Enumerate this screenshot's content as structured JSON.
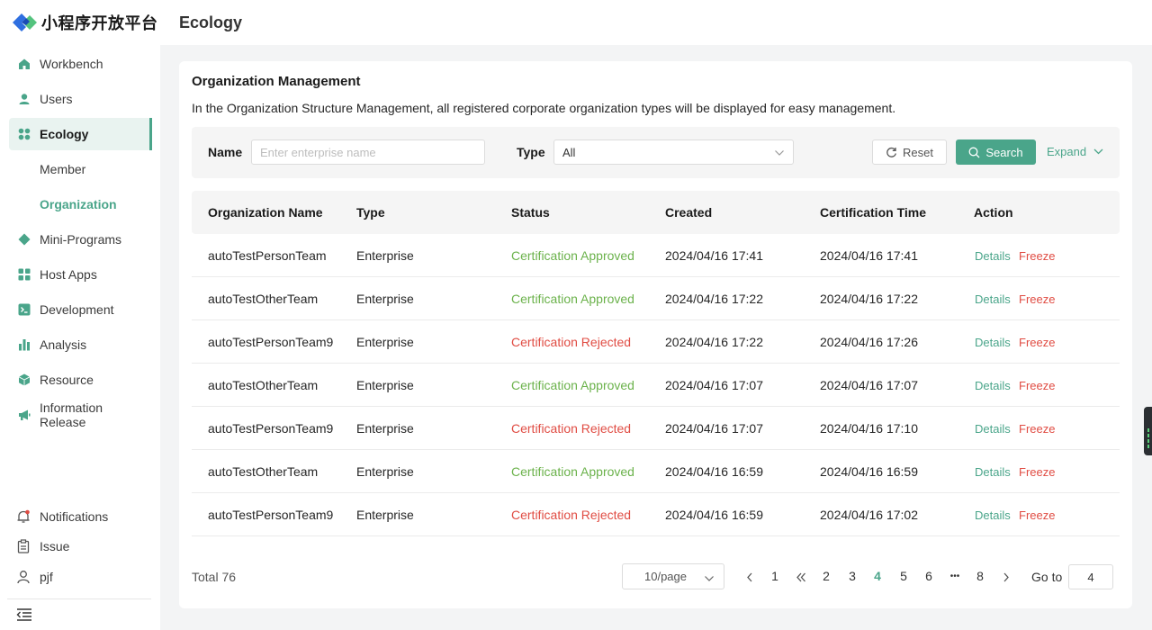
{
  "app": {
    "logo_text": "小程序开放平台"
  },
  "sidebar": {
    "items": [
      {
        "label": "Workbench",
        "icon": "home-icon"
      },
      {
        "label": "Users",
        "icon": "user-icon"
      },
      {
        "label": "Ecology",
        "icon": "grid-icon",
        "active": true
      },
      {
        "label": "Mini-Programs",
        "icon": "diamond-icon"
      },
      {
        "label": "Host Apps",
        "icon": "apps-icon"
      },
      {
        "label": "Development",
        "icon": "terminal-icon"
      },
      {
        "label": "Analysis",
        "icon": "bar-chart-icon"
      },
      {
        "label": "Resource",
        "icon": "cube-icon"
      },
      {
        "label": "Information Release",
        "icon": "megaphone-icon"
      }
    ],
    "sub_items": [
      {
        "label": "Member"
      },
      {
        "label": "Organization",
        "active": true
      }
    ],
    "bottom": [
      {
        "label": "Notifications",
        "icon": "bell-icon"
      },
      {
        "label": "Issue",
        "icon": "clipboard-icon"
      },
      {
        "label": "pjf",
        "icon": "person-icon"
      }
    ]
  },
  "header": {
    "title": "Ecology"
  },
  "card": {
    "title": "Organization Management",
    "description": "In the Organization Structure Management, all registered corporate organization types will be displayed for easy management."
  },
  "filters": {
    "name_label": "Name",
    "name_placeholder": "Enter enterprise name",
    "type_label": "Type",
    "type_value": "All",
    "reset_label": "Reset",
    "search_label": "Search",
    "expand_label": "Expand"
  },
  "table": {
    "columns": [
      "Organization Name",
      "Type",
      "Status",
      "Created",
      "Certification Time",
      "Action"
    ],
    "rows": [
      {
        "name": "autoTestPersonTeam",
        "type": "Enterprise",
        "status": "Certification Approved",
        "created": "2024/04/16 17:41",
        "cert_time": "2024/04/16 17:41",
        "details": "Details",
        "freeze": "Freeze"
      },
      {
        "name": "autoTestOtherTeam",
        "type": "Enterprise",
        "status": "Certification Approved",
        "created": "2024/04/16 17:22",
        "cert_time": "2024/04/16 17:22",
        "details": "Details",
        "freeze": "Freeze"
      },
      {
        "name": "autoTestPersonTeam9",
        "type": "Enterprise",
        "status": "Certification Rejected",
        "created": "2024/04/16 17:22",
        "cert_time": "2024/04/16 17:26",
        "details": "Details",
        "freeze": "Freeze"
      },
      {
        "name": "autoTestOtherTeam",
        "type": "Enterprise",
        "status": "Certification Approved",
        "created": "2024/04/16 17:07",
        "cert_time": "2024/04/16 17:07",
        "details": "Details",
        "freeze": "Freeze"
      },
      {
        "name": "autoTestPersonTeam9",
        "type": "Enterprise",
        "status": "Certification Rejected",
        "created": "2024/04/16 17:07",
        "cert_time": "2024/04/16 17:10",
        "details": "Details",
        "freeze": "Freeze"
      },
      {
        "name": "autoTestOtherTeam",
        "type": "Enterprise",
        "status": "Certification Approved",
        "created": "2024/04/16 16:59",
        "cert_time": "2024/04/16 16:59",
        "details": "Details",
        "freeze": "Freeze"
      },
      {
        "name": "autoTestPersonTeam9",
        "type": "Enterprise",
        "status": "Certification Rejected",
        "created": "2024/04/16 16:59",
        "cert_time": "2024/04/16 17:02",
        "details": "Details",
        "freeze": "Freeze"
      }
    ]
  },
  "pagination": {
    "total": "Total 76",
    "page_size": "10/page",
    "pages": [
      "1",
      "2",
      "3",
      "4",
      "5",
      "6",
      "8"
    ],
    "current": "4",
    "ellipsis": "•••",
    "goto_label": "Go to",
    "goto_value": "4"
  },
  "colors": {
    "accent": "#4aa58a",
    "approved": "#6bb24b",
    "rejected": "#e04c43"
  }
}
